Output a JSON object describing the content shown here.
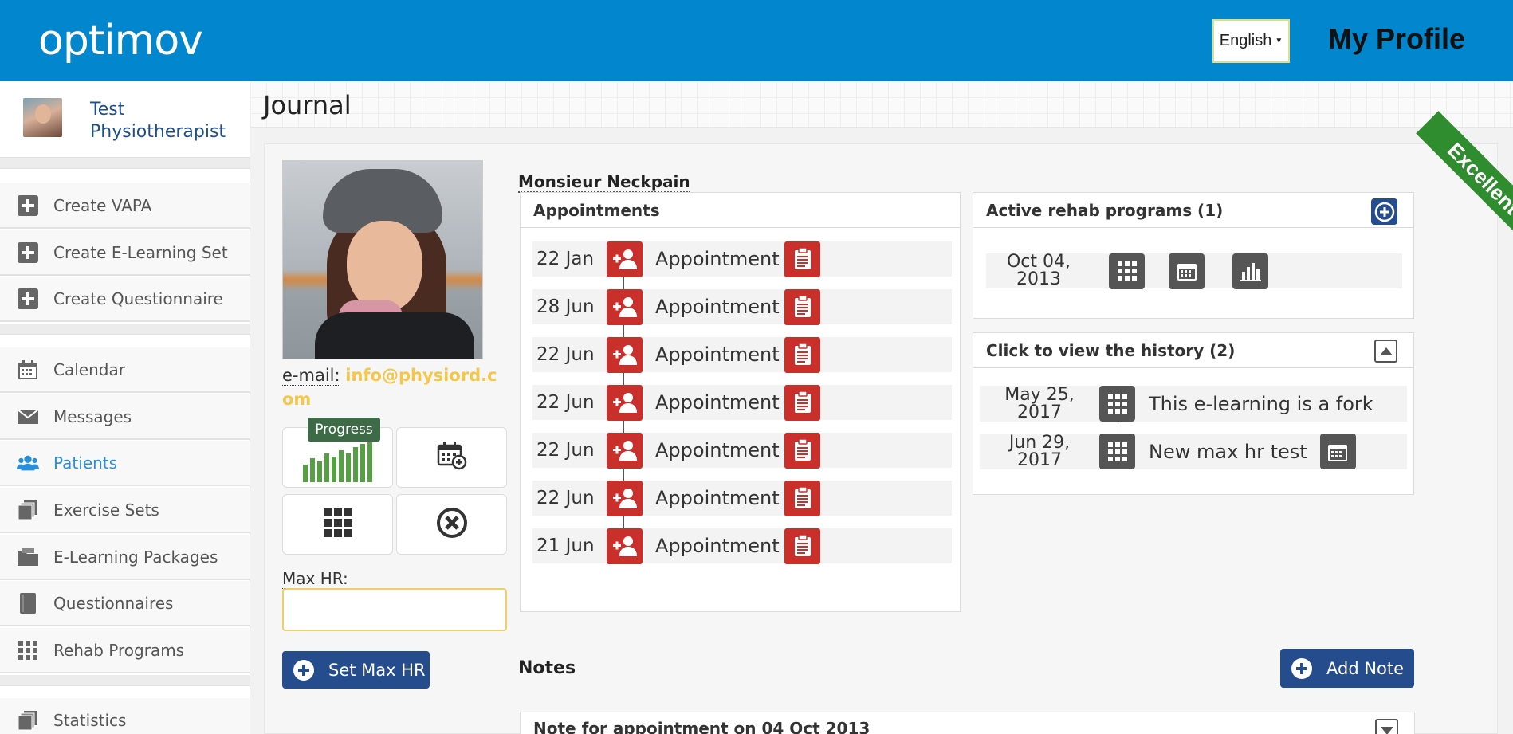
{
  "header": {
    "logo_text": "optimov",
    "language": "English",
    "page_title": "My Profile"
  },
  "sidebar": {
    "user_name": "Test Physiotherapist",
    "items": [
      {
        "label": "Create VAPA",
        "icon": "plus-square-icon"
      },
      {
        "label": "Create E-Learning Set",
        "icon": "plus-square-icon"
      },
      {
        "label": "Create Questionnaire",
        "icon": "plus-square-icon"
      },
      {
        "label": "Calendar",
        "icon": "calendar-icon"
      },
      {
        "label": "Messages",
        "icon": "envelope-icon"
      },
      {
        "label": "Patients",
        "icon": "users-icon",
        "active": true
      },
      {
        "label": "Exercise Sets",
        "icon": "copy-icon"
      },
      {
        "label": "E-Learning Packages",
        "icon": "folder-icon"
      },
      {
        "label": "Questionnaires",
        "icon": "book-icon"
      },
      {
        "label": "Rehab Programs",
        "icon": "grid-icon"
      },
      {
        "label": "Statistics",
        "icon": "copy-icon"
      }
    ]
  },
  "main": {
    "section_title": "Journal",
    "ribbon": "Excellent",
    "patient": {
      "name": "Monsieur Neckpain",
      "email_label": "e-mail:",
      "email": "info@physiord.com",
      "progress_tooltip": "Progress",
      "max_hr_label": "Max HR:",
      "max_hr_value": "",
      "set_max_hr_button": "Set Max HR"
    },
    "appointments": {
      "title": "Appointments",
      "rows": [
        {
          "date": "22 Jan",
          "label": "Appointment"
        },
        {
          "date": "28 Jun",
          "label": "Appointment"
        },
        {
          "date": "22 Jun",
          "label": "Appointment"
        },
        {
          "date": "22 Jun",
          "label": "Appointment"
        },
        {
          "date": "22 Jun",
          "label": "Appointment"
        },
        {
          "date": "22 Jun",
          "label": "Appointment"
        },
        {
          "date": "21 Jun",
          "label": "Appointment"
        }
      ]
    },
    "active_programs": {
      "title": "Active rehab programs (1)",
      "rows": [
        {
          "date_line1": "Oct 04,",
          "date_line2": "2013"
        }
      ]
    },
    "history": {
      "title": "Click to view the history (2)",
      "rows": [
        {
          "date_line1": "May 25,",
          "date_line2": "2017",
          "label": "This e-learning is a fork"
        },
        {
          "date_line1": "Jun 29,",
          "date_line2": "2017",
          "label": "New max hr test"
        }
      ]
    },
    "notes": {
      "title": "Notes",
      "add_button": "Add Note",
      "items": [
        {
          "title": "Note for appointment on 04 Oct 2013"
        }
      ]
    }
  }
}
